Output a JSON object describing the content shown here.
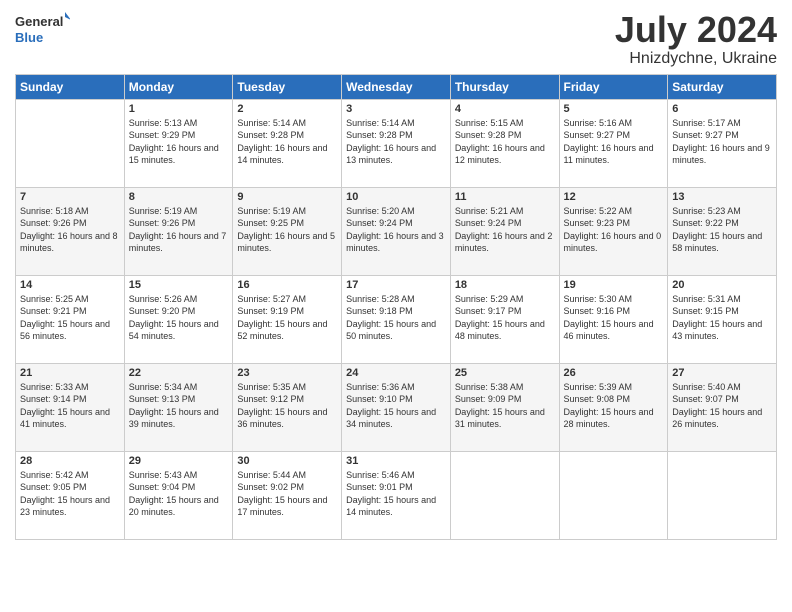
{
  "header": {
    "logo_general": "General",
    "logo_blue": "Blue",
    "title": "July 2024",
    "location": "Hnizdychne, Ukraine"
  },
  "calendar": {
    "days_of_week": [
      "Sunday",
      "Monday",
      "Tuesday",
      "Wednesday",
      "Thursday",
      "Friday",
      "Saturday"
    ],
    "weeks": [
      [
        {
          "day": "",
          "sunrise": "",
          "sunset": "",
          "daylight": ""
        },
        {
          "day": "1",
          "sunrise": "Sunrise: 5:13 AM",
          "sunset": "Sunset: 9:29 PM",
          "daylight": "Daylight: 16 hours and 15 minutes."
        },
        {
          "day": "2",
          "sunrise": "Sunrise: 5:14 AM",
          "sunset": "Sunset: 9:28 PM",
          "daylight": "Daylight: 16 hours and 14 minutes."
        },
        {
          "day": "3",
          "sunrise": "Sunrise: 5:14 AM",
          "sunset": "Sunset: 9:28 PM",
          "daylight": "Daylight: 16 hours and 13 minutes."
        },
        {
          "day": "4",
          "sunrise": "Sunrise: 5:15 AM",
          "sunset": "Sunset: 9:28 PM",
          "daylight": "Daylight: 16 hours and 12 minutes."
        },
        {
          "day": "5",
          "sunrise": "Sunrise: 5:16 AM",
          "sunset": "Sunset: 9:27 PM",
          "daylight": "Daylight: 16 hours and 11 minutes."
        },
        {
          "day": "6",
          "sunrise": "Sunrise: 5:17 AM",
          "sunset": "Sunset: 9:27 PM",
          "daylight": "Daylight: 16 hours and 9 minutes."
        }
      ],
      [
        {
          "day": "7",
          "sunrise": "Sunrise: 5:18 AM",
          "sunset": "Sunset: 9:26 PM",
          "daylight": "Daylight: 16 hours and 8 minutes."
        },
        {
          "day": "8",
          "sunrise": "Sunrise: 5:19 AM",
          "sunset": "Sunset: 9:26 PM",
          "daylight": "Daylight: 16 hours and 7 minutes."
        },
        {
          "day": "9",
          "sunrise": "Sunrise: 5:19 AM",
          "sunset": "Sunset: 9:25 PM",
          "daylight": "Daylight: 16 hours and 5 minutes."
        },
        {
          "day": "10",
          "sunrise": "Sunrise: 5:20 AM",
          "sunset": "Sunset: 9:24 PM",
          "daylight": "Daylight: 16 hours and 3 minutes."
        },
        {
          "day": "11",
          "sunrise": "Sunrise: 5:21 AM",
          "sunset": "Sunset: 9:24 PM",
          "daylight": "Daylight: 16 hours and 2 minutes."
        },
        {
          "day": "12",
          "sunrise": "Sunrise: 5:22 AM",
          "sunset": "Sunset: 9:23 PM",
          "daylight": "Daylight: 16 hours and 0 minutes."
        },
        {
          "day": "13",
          "sunrise": "Sunrise: 5:23 AM",
          "sunset": "Sunset: 9:22 PM",
          "daylight": "Daylight: 15 hours and 58 minutes."
        }
      ],
      [
        {
          "day": "14",
          "sunrise": "Sunrise: 5:25 AM",
          "sunset": "Sunset: 9:21 PM",
          "daylight": "Daylight: 15 hours and 56 minutes."
        },
        {
          "day": "15",
          "sunrise": "Sunrise: 5:26 AM",
          "sunset": "Sunset: 9:20 PM",
          "daylight": "Daylight: 15 hours and 54 minutes."
        },
        {
          "day": "16",
          "sunrise": "Sunrise: 5:27 AM",
          "sunset": "Sunset: 9:19 PM",
          "daylight": "Daylight: 15 hours and 52 minutes."
        },
        {
          "day": "17",
          "sunrise": "Sunrise: 5:28 AM",
          "sunset": "Sunset: 9:18 PM",
          "daylight": "Daylight: 15 hours and 50 minutes."
        },
        {
          "day": "18",
          "sunrise": "Sunrise: 5:29 AM",
          "sunset": "Sunset: 9:17 PM",
          "daylight": "Daylight: 15 hours and 48 minutes."
        },
        {
          "day": "19",
          "sunrise": "Sunrise: 5:30 AM",
          "sunset": "Sunset: 9:16 PM",
          "daylight": "Daylight: 15 hours and 46 minutes."
        },
        {
          "day": "20",
          "sunrise": "Sunrise: 5:31 AM",
          "sunset": "Sunset: 9:15 PM",
          "daylight": "Daylight: 15 hours and 43 minutes."
        }
      ],
      [
        {
          "day": "21",
          "sunrise": "Sunrise: 5:33 AM",
          "sunset": "Sunset: 9:14 PM",
          "daylight": "Daylight: 15 hours and 41 minutes."
        },
        {
          "day": "22",
          "sunrise": "Sunrise: 5:34 AM",
          "sunset": "Sunset: 9:13 PM",
          "daylight": "Daylight: 15 hours and 39 minutes."
        },
        {
          "day": "23",
          "sunrise": "Sunrise: 5:35 AM",
          "sunset": "Sunset: 9:12 PM",
          "daylight": "Daylight: 15 hours and 36 minutes."
        },
        {
          "day": "24",
          "sunrise": "Sunrise: 5:36 AM",
          "sunset": "Sunset: 9:10 PM",
          "daylight": "Daylight: 15 hours and 34 minutes."
        },
        {
          "day": "25",
          "sunrise": "Sunrise: 5:38 AM",
          "sunset": "Sunset: 9:09 PM",
          "daylight": "Daylight: 15 hours and 31 minutes."
        },
        {
          "day": "26",
          "sunrise": "Sunrise: 5:39 AM",
          "sunset": "Sunset: 9:08 PM",
          "daylight": "Daylight: 15 hours and 28 minutes."
        },
        {
          "day": "27",
          "sunrise": "Sunrise: 5:40 AM",
          "sunset": "Sunset: 9:07 PM",
          "daylight": "Daylight: 15 hours and 26 minutes."
        }
      ],
      [
        {
          "day": "28",
          "sunrise": "Sunrise: 5:42 AM",
          "sunset": "Sunset: 9:05 PM",
          "daylight": "Daylight: 15 hours and 23 minutes."
        },
        {
          "day": "29",
          "sunrise": "Sunrise: 5:43 AM",
          "sunset": "Sunset: 9:04 PM",
          "daylight": "Daylight: 15 hours and 20 minutes."
        },
        {
          "day": "30",
          "sunrise": "Sunrise: 5:44 AM",
          "sunset": "Sunset: 9:02 PM",
          "daylight": "Daylight: 15 hours and 17 minutes."
        },
        {
          "day": "31",
          "sunrise": "Sunrise: 5:46 AM",
          "sunset": "Sunset: 9:01 PM",
          "daylight": "Daylight: 15 hours and 14 minutes."
        },
        {
          "day": "",
          "sunrise": "",
          "sunset": "",
          "daylight": ""
        },
        {
          "day": "",
          "sunrise": "",
          "sunset": "",
          "daylight": ""
        },
        {
          "day": "",
          "sunrise": "",
          "sunset": "",
          "daylight": ""
        }
      ]
    ]
  }
}
